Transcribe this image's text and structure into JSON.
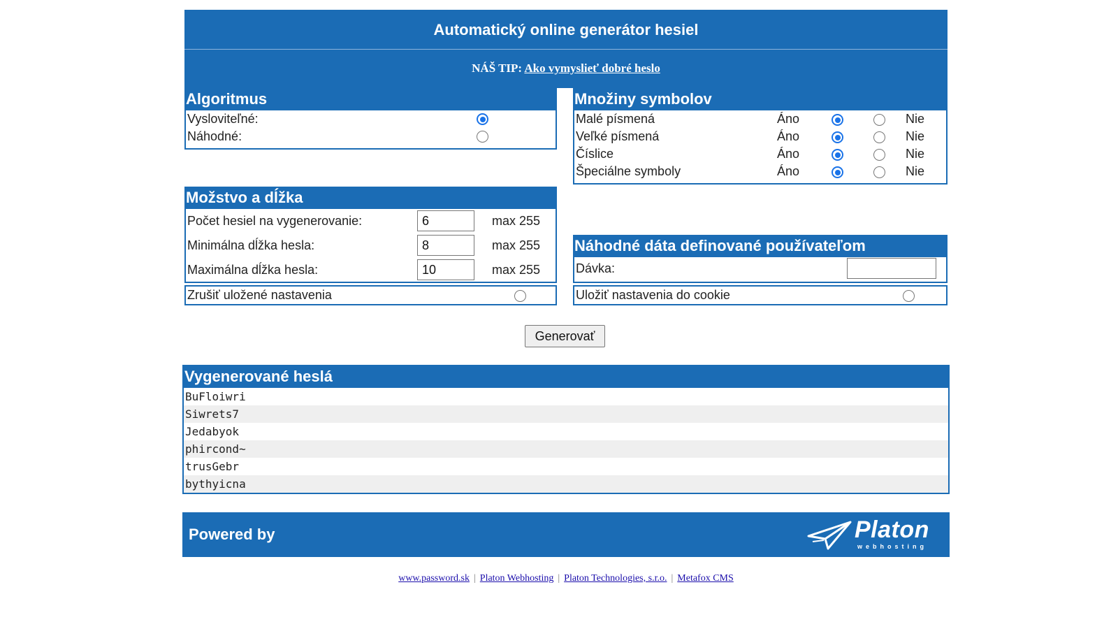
{
  "header": {
    "title": "Automatický online generátor hesiel",
    "tip_prefix": "NÁŠ TIP:",
    "tip_link": "Ako vymyslieť dobré heslo"
  },
  "algorithm": {
    "title": "Algoritmus",
    "options": [
      {
        "label": "Vysloviteľné:",
        "selected": true
      },
      {
        "label": "Náhodné:",
        "selected": false
      }
    ]
  },
  "symbols": {
    "title": "Množiny symbolov",
    "yes_label": "Áno",
    "no_label": "Nie",
    "rows": [
      {
        "label": "Malé písmená",
        "value": "yes"
      },
      {
        "label": "Veľké písmená",
        "value": "yes"
      },
      {
        "label": "Číslice",
        "value": "yes"
      },
      {
        "label": "Špeciálne symboly",
        "value": "yes"
      }
    ]
  },
  "quantity": {
    "title": "Možstvo a dĺžka",
    "rows": [
      {
        "label": "Počet hesiel na vygenerovanie:",
        "value": "6",
        "max": "max 255"
      },
      {
        "label": "Minimálna dĺžka hesla:",
        "value": "8",
        "max": "max 255"
      },
      {
        "label": "Maximálna dĺžka hesla:",
        "value": "10",
        "max": "max 255"
      }
    ],
    "reset_label": "Zrušiť uložené nastavenia"
  },
  "random_data": {
    "title": "Náhodné dáta definované používateľom",
    "batch_label": "Dávka:",
    "batch_value": "",
    "cookie_label": "Uložiť nastavenia do cookie"
  },
  "generate_button": "Generovať",
  "results": {
    "title": "Vygenerované heslá",
    "passwords": [
      "BuFloiwri",
      "Siwrets7",
      "Jedabyok",
      "phircond~",
      "trusGebr",
      "bythyicna"
    ]
  },
  "powered": {
    "text": "Powered by",
    "logo_word": "Platon",
    "logo_sub": "webhosting"
  },
  "footer_links": [
    "www.password.sk",
    "Platon Webhosting",
    "Platon Technologies, s.r.o.",
    "Metafox CMS"
  ],
  "colors": {
    "accent": "#1b6cb5",
    "radio": "#1a73e8"
  }
}
